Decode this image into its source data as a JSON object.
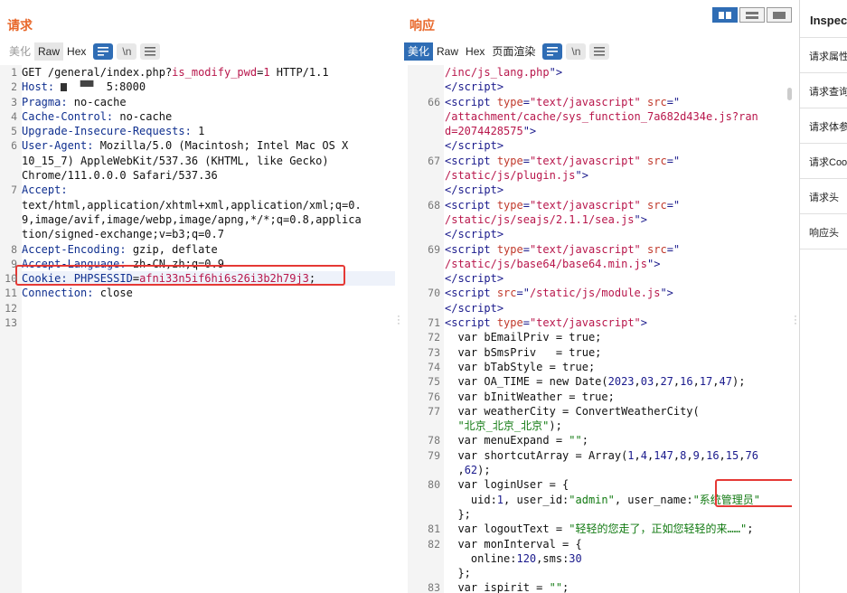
{
  "request": {
    "title": "请求",
    "tabs": [
      "美化",
      "Raw",
      "Hex"
    ],
    "lines": [
      {
        "n": "1",
        "parts": [
          [
            "GET /general/index.php?",
            ""
          ],
          [
            "is_modify_pwd",
            "v"
          ],
          [
            "=",
            ""
          ],
          [
            "1",
            "v"
          ],
          [
            " HTTP/1.1",
            ""
          ]
        ]
      },
      {
        "n": "2",
        "parts": [
          [
            "Host: ",
            "k"
          ],
          [
            "█",
            "redact"
          ],
          [
            "  ▀▀  ",
            "redact2"
          ],
          [
            "5:8000",
            ""
          ]
        ]
      },
      {
        "n": "3",
        "parts": [
          [
            "Pragma: ",
            "k"
          ],
          [
            "no-cache",
            ""
          ]
        ]
      },
      {
        "n": "4",
        "parts": [
          [
            "Cache-Control: ",
            "k"
          ],
          [
            "no-cache",
            ""
          ]
        ]
      },
      {
        "n": "5",
        "parts": [
          [
            "Upgrade-Insecure-Requests: ",
            "k"
          ],
          [
            "1",
            ""
          ]
        ]
      },
      {
        "n": "6",
        "parts": [
          [
            "User-Agent: ",
            "k"
          ],
          [
            "Mozilla/5.0 (Macintosh; Intel Mac OS X",
            ""
          ]
        ]
      },
      {
        "n": "",
        "parts": [
          [
            "10_15_7) AppleWebKit/537.36 (KHTML, like Gecko)",
            ""
          ]
        ]
      },
      {
        "n": "",
        "parts": [
          [
            "Chrome/111.0.0.0 Safari/537.36",
            ""
          ]
        ]
      },
      {
        "n": "7",
        "parts": [
          [
            "Accept:",
            "k"
          ]
        ]
      },
      {
        "n": "",
        "parts": [
          [
            "text/html,application/xhtml+xml,application/xml;q=0.",
            ""
          ]
        ]
      },
      {
        "n": "",
        "parts": [
          [
            "9,image/avif,image/webp,image/apng,*/*;q=0.8,applica",
            ""
          ]
        ]
      },
      {
        "n": "",
        "parts": [
          [
            "tion/signed-exchange;v=b3;q=0.7",
            ""
          ]
        ]
      },
      {
        "n": "8",
        "parts": [
          [
            "Accept-Encoding: ",
            "k"
          ],
          [
            "gzip, deflate",
            ""
          ]
        ]
      },
      {
        "n": "9",
        "parts": [
          [
            "Accept-Language: ",
            "k"
          ],
          [
            "zh-CN,zh;q=0.9",
            ""
          ]
        ]
      },
      {
        "n": "10",
        "parts": [
          [
            "Cookie: ",
            "k"
          ],
          [
            "PHPSESSID",
            "k"
          ],
          [
            "=",
            ""
          ],
          [
            "afni33n5if6hi6s26i3b2h79j3",
            "v"
          ],
          [
            ";",
            ""
          ]
        ]
      },
      {
        "n": "11",
        "parts": [
          [
            "Connection: ",
            "k"
          ],
          [
            "close",
            ""
          ]
        ]
      },
      {
        "n": "12",
        "parts": [
          [
            "",
            ""
          ]
        ]
      },
      {
        "n": "13",
        "parts": [
          [
            "",
            ""
          ]
        ]
      }
    ]
  },
  "response": {
    "title": "响应",
    "tabs": [
      "美化",
      "Raw",
      "Hex",
      "页面渲染"
    ],
    "lines": [
      {
        "n": "",
        "parts": [
          [
            "/inc/js_lang.php",
            "str"
          ],
          [
            "\">",
            "tg"
          ]
        ]
      },
      {
        "n": "",
        "parts": [
          [
            "</",
            "tg"
          ],
          [
            "script",
            "tg"
          ],
          [
            ">",
            "tg"
          ]
        ]
      },
      {
        "n": "66",
        "parts": [
          [
            "<",
            "tg"
          ],
          [
            "script ",
            "tg"
          ],
          [
            "type",
            "at"
          ],
          [
            "=",
            "tg"
          ],
          [
            "\"text/javascript\"",
            "str"
          ],
          [
            " src",
            "at"
          ],
          [
            "=\"",
            "tg"
          ]
        ]
      },
      {
        "n": "",
        "parts": [
          [
            "/attachment/cache/sys_function_7a682d434e.js?ran",
            "str"
          ]
        ]
      },
      {
        "n": "",
        "parts": [
          [
            "d=2074428575",
            "str"
          ],
          [
            "\">",
            "tg"
          ]
        ]
      },
      {
        "n": "",
        "parts": [
          [
            "</",
            "tg"
          ],
          [
            "script",
            "tg"
          ],
          [
            ">",
            "tg"
          ]
        ]
      },
      {
        "n": "67",
        "parts": [
          [
            "<",
            "tg"
          ],
          [
            "script ",
            "tg"
          ],
          [
            "type",
            "at"
          ],
          [
            "=",
            "tg"
          ],
          [
            "\"text/javascript\"",
            "str"
          ],
          [
            " src",
            "at"
          ],
          [
            "=\"",
            "tg"
          ]
        ]
      },
      {
        "n": "",
        "parts": [
          [
            "/static/js/plugin.js",
            "str"
          ],
          [
            "\">",
            "tg"
          ]
        ]
      },
      {
        "n": "",
        "parts": [
          [
            "</",
            "tg"
          ],
          [
            "script",
            "tg"
          ],
          [
            ">",
            "tg"
          ]
        ]
      },
      {
        "n": "68",
        "parts": [
          [
            "<",
            "tg"
          ],
          [
            "script ",
            "tg"
          ],
          [
            "type",
            "at"
          ],
          [
            "=",
            "tg"
          ],
          [
            "\"text/javascript\"",
            "str"
          ],
          [
            " src",
            "at"
          ],
          [
            "=\"",
            "tg"
          ]
        ]
      },
      {
        "n": "",
        "parts": [
          [
            "/static/js/seajs/2.1.1/sea.js",
            "str"
          ],
          [
            "\">",
            "tg"
          ]
        ]
      },
      {
        "n": "",
        "parts": [
          [
            "</",
            "tg"
          ],
          [
            "script",
            "tg"
          ],
          [
            ">",
            "tg"
          ]
        ]
      },
      {
        "n": "69",
        "parts": [
          [
            "<",
            "tg"
          ],
          [
            "script ",
            "tg"
          ],
          [
            "type",
            "at"
          ],
          [
            "=",
            "tg"
          ],
          [
            "\"text/javascript\"",
            "str"
          ],
          [
            " src",
            "at"
          ],
          [
            "=\"",
            "tg"
          ]
        ]
      },
      {
        "n": "",
        "parts": [
          [
            "/static/js/base64/base64.min.js",
            "str"
          ],
          [
            "\">",
            "tg"
          ]
        ]
      },
      {
        "n": "",
        "parts": [
          [
            "</",
            "tg"
          ],
          [
            "script",
            "tg"
          ],
          [
            ">",
            "tg"
          ]
        ]
      },
      {
        "n": "70",
        "parts": [
          [
            "<",
            "tg"
          ],
          [
            "script ",
            "tg"
          ],
          [
            "src",
            "at"
          ],
          [
            "=\"",
            "tg"
          ],
          [
            "/static/js/module.js",
            "str"
          ],
          [
            "\">",
            "tg"
          ]
        ]
      },
      {
        "n": "",
        "parts": [
          [
            "</",
            "tg"
          ],
          [
            "script",
            "tg"
          ],
          [
            ">",
            "tg"
          ]
        ]
      },
      {
        "n": "71",
        "parts": [
          [
            "<",
            "tg"
          ],
          [
            "script ",
            "tg"
          ],
          [
            "type",
            "at"
          ],
          [
            "=",
            "tg"
          ],
          [
            "\"text/javascript\"",
            "str"
          ],
          [
            ">",
            "tg"
          ]
        ]
      },
      {
        "n": "72",
        "parts": [
          [
            "  var bEmailPriv = true;",
            ""
          ]
        ]
      },
      {
        "n": "73",
        "parts": [
          [
            "  var bSmsPriv   = true;",
            ""
          ]
        ]
      },
      {
        "n": "74",
        "parts": [
          [
            "  var bTabStyle = true;",
            ""
          ]
        ]
      },
      {
        "n": "75",
        "parts": [
          [
            "  var OA_TIME = new Date(",
            ""
          ],
          [
            "2023",
            "num"
          ],
          [
            ",",
            ""
          ],
          [
            "03",
            "num"
          ],
          [
            ",",
            ""
          ],
          [
            "27",
            "num"
          ],
          [
            ",",
            ""
          ],
          [
            "16",
            "num"
          ],
          [
            ",",
            ""
          ],
          [
            "17",
            "num"
          ],
          [
            ",",
            ""
          ],
          [
            "47",
            "num"
          ],
          [
            ");",
            ""
          ]
        ]
      },
      {
        "n": "76",
        "parts": [
          [
            "  var bInitWeather = true;",
            ""
          ]
        ]
      },
      {
        "n": "77",
        "parts": [
          [
            "  var weatherCity = ConvertWeatherCity(",
            ""
          ]
        ]
      },
      {
        "n": "",
        "parts": [
          [
            "  ",
            ""
          ],
          [
            "\"北京_北京_北京\"",
            "gstr"
          ],
          [
            ");",
            ""
          ]
        ]
      },
      {
        "n": "78",
        "parts": [
          [
            "  var menuExpand = ",
            ""
          ],
          [
            "\"\"",
            "gstr"
          ],
          [
            ";",
            ""
          ]
        ]
      },
      {
        "n": "79",
        "parts": [
          [
            "  var shortcutArray = Array(",
            ""
          ],
          [
            "1",
            "num"
          ],
          [
            ",",
            ""
          ],
          [
            "4",
            "num"
          ],
          [
            ",",
            ""
          ],
          [
            "147",
            "num"
          ],
          [
            ",",
            ""
          ],
          [
            "8",
            "num"
          ],
          [
            ",",
            ""
          ],
          [
            "9",
            "num"
          ],
          [
            ",",
            ""
          ],
          [
            "16",
            "num"
          ],
          [
            ",",
            ""
          ],
          [
            "15",
            "num"
          ],
          [
            ",",
            ""
          ],
          [
            "76",
            "num"
          ]
        ]
      },
      {
        "n": "",
        "parts": [
          [
            "  ,",
            ""
          ],
          [
            "62",
            "num"
          ],
          [
            ");",
            ""
          ]
        ]
      },
      {
        "n": "80",
        "parts": [
          [
            "  var loginUser = {",
            ""
          ]
        ]
      },
      {
        "n": "",
        "parts": [
          [
            "    uid:",
            ""
          ],
          [
            "1",
            "num"
          ],
          [
            ", user_id:",
            ""
          ],
          [
            "\"admin\"",
            "gstr"
          ],
          [
            ", user_name:",
            ""
          ],
          [
            "\"系统管理员\"",
            "gstr"
          ]
        ]
      },
      {
        "n": "",
        "parts": [
          [
            "  };",
            ""
          ]
        ]
      },
      {
        "n": "81",
        "parts": [
          [
            "  var logoutText = ",
            ""
          ],
          [
            "\"轻轻的您走了，正如您轻轻的来……\"",
            "gstr"
          ],
          [
            ";",
            ""
          ]
        ]
      },
      {
        "n": "82",
        "parts": [
          [
            "  var monInterval = {",
            ""
          ]
        ]
      },
      {
        "n": "",
        "parts": [
          [
            "    online:",
            ""
          ],
          [
            "120",
            "num"
          ],
          [
            ",sms:",
            ""
          ],
          [
            "30",
            "num"
          ]
        ]
      },
      {
        "n": "",
        "parts": [
          [
            "  };",
            ""
          ]
        ]
      },
      {
        "n": "83",
        "parts": [
          [
            "  var ispirit = ",
            ""
          ],
          [
            "\"\"",
            "gstr"
          ],
          [
            ";",
            ""
          ]
        ]
      }
    ]
  },
  "inspector": {
    "title": "Inspector",
    "items": [
      "请求属性",
      "请求查询参数",
      "请求体参数",
      "请求Cookies",
      "请求头",
      "响应头"
    ]
  },
  "colors": {
    "accent": "#2f6db5",
    "title": "#e8672a",
    "highlight": "#e53935"
  }
}
